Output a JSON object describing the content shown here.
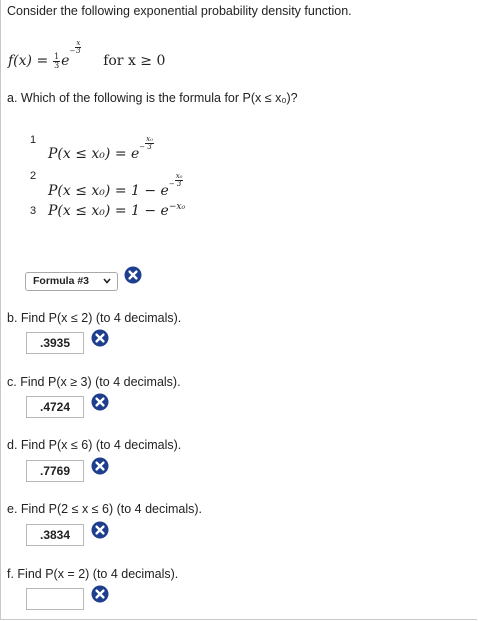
{
  "intro": "Consider the following exponential probability density function.",
  "pdf": {
    "lhs": "f(x) =",
    "frac_num": "1",
    "frac_den": "3",
    "base": "e",
    "exp_sign": "−",
    "exp_num": "x",
    "exp_den": "3",
    "condition": "for  x ≥ 0"
  },
  "part_a": {
    "question": "a. Which of the following is the formula for P(x ≤ x₀)?",
    "options": [
      {
        "num": "1",
        "formula": "P(x ≤ x₀) = e",
        "exp": "−",
        "exp_num": "x₀",
        "exp_den": "3"
      },
      {
        "num": "2",
        "formula": "P(x ≤ x₀) = 1 − e",
        "exp": "−",
        "exp_num": "x₀",
        "exp_den": "3"
      },
      {
        "num": "3",
        "formula": "P(x ≤ x₀) = 1 − e",
        "exp_plain": "−x₀"
      }
    ],
    "selected": "Formula #3",
    "chevron": "chevron-down-icon"
  },
  "part_b": {
    "question": "b. Find P(x ≤ 2) (to 4 decimals).",
    "answer": ".3935"
  },
  "part_c": {
    "question": "c. Find P(x ≥ 3) (to 4 decimals).",
    "answer": ".4724"
  },
  "part_d": {
    "question": "d. Find P(x ≤ 6) (to 4 decimals).",
    "answer": ".7769"
  },
  "part_e": {
    "question": "e. Find P(2 ≤ x ≤ 6) (to 4 decimals).",
    "answer": ".3834"
  },
  "part_f": {
    "question": "f. Find P(x = 2) (to 4 decimals).",
    "answer": ""
  },
  "colors": {
    "incorrect_icon": "#1e3f8f",
    "border": "#b9b9b9"
  },
  "icons": {
    "incorrect": "incorrect-x-icon"
  }
}
